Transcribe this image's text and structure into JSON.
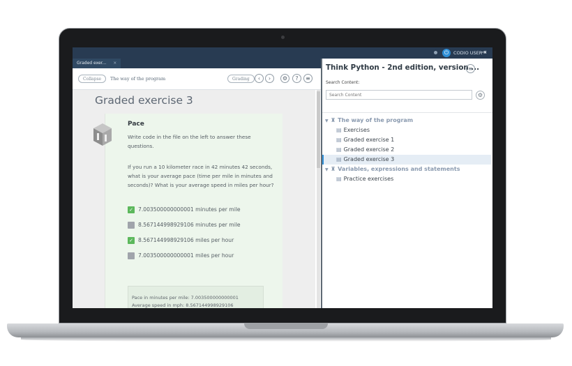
{
  "topbar": {
    "user_label": "CODIO USER",
    "power_icon": "power-icon",
    "logout_icon": "logout-icon"
  },
  "left": {
    "tab_label": "Graded exer...",
    "tab_close": "×",
    "collapse_label": "Collapse",
    "breadcrumb": "The way of the program",
    "grading_label": "Grading",
    "prev_glyph": "‹",
    "next_glyph": "›",
    "gear_glyph": "⚙",
    "help_glyph": "?",
    "menu_glyph": "≡",
    "exercise_title": "Graded exercise 3",
    "card": {
      "title": "Pace",
      "instruction": "Write code in the file on the left to answer these questions.",
      "question": "If you run a 10 kilometer race in 42 minutes 42 seconds, what is your average pace (time per mile in minutes and seconds)? What is your average speed in miles per hour?",
      "check_glyph": "✓",
      "options": [
        {
          "label": "7.003500000000001 minutes per mile",
          "checked": true
        },
        {
          "label": "8.567144998929106 minutes per mile",
          "checked": false
        },
        {
          "label": "8.567144998929106 miles per hour",
          "checked": true
        },
        {
          "label": "7.003500000000001 miles per hour",
          "checked": false
        }
      ],
      "result_lines": [
        "Pace in minutes per mile: 7.003500000000001",
        "Average speed in mph: 8.567144998929106"
      ]
    }
  },
  "right": {
    "book_title": "Think Python - 2nd edition, version ...",
    "menu_glyph": "≡",
    "search_label": "Search Content:",
    "search_placeholder": "Search Content",
    "gear_glyph": "⚙",
    "caret_glyph": "▼",
    "book_glyph": "♜",
    "page_glyph": "▤",
    "tree": [
      {
        "label": "The way of the program",
        "type": "section"
      },
      {
        "label": "Exercises",
        "type": "item"
      },
      {
        "label": "Graded exercise 1",
        "type": "item"
      },
      {
        "label": "Graded exercise 2",
        "type": "item"
      },
      {
        "label": "Graded exercise 3",
        "type": "item",
        "active": true
      },
      {
        "label": "Variables, expressions and statements",
        "type": "section"
      },
      {
        "label": "Practice exercises",
        "type": "item"
      }
    ]
  },
  "colors": {
    "topbar": "#283b52",
    "accent": "#2d8ed6",
    "check": "#5cb85c",
    "card": "#edf6ec"
  }
}
